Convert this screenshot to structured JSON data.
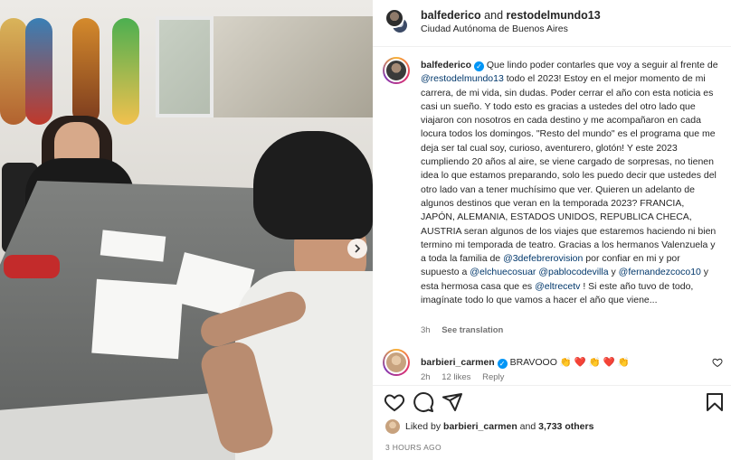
{
  "header": {
    "user1": "balfederico",
    "and_text": "and",
    "user2": "restodelmundo13",
    "location": "Ciudad Autónoma de Buenos Aires"
  },
  "caption": {
    "username": "balfederico",
    "t1": "Que lindo poder contarles que voy a seguir al frente de ",
    "m1": "@restodelmundo13",
    "t2": " todo el 2023! Estoy en el mejor momento de mi carrera, de mi vida, sin dudas. Poder cerrar el año con esta noticia es casi un sueño. Y todo esto es gracias a ustedes del otro lado que viajaron con nosotros en cada destino y me acompañaron en cada locura todos los domingos. \"Resto del mundo\" es el programa que me deja ser tal cual soy, curioso, aventurero, glotón! Y este 2023 cumpliendo 20 años al aire, se viene cargado de sorpresas, no tienen idea lo que estamos preparando, solo les puedo decir que ustedes del otro lado van a tener muchísimo que ver. Quieren un adelanto de algunos destinos que veran en la temporada 2023? FRANCIA, JAPÓN, ALEMANIA, ESTADOS UNIDOS, REPUBLICA CHECA, AUSTRIA seran algunos de los viajes que estaremos haciendo ni bien termino mi temporada de teatro. Gracias a los hermanos Valenzuela y a toda la familia de ",
    "m2": "@3defebrerovision",
    "t3": " por confiar en mi y por supuesto a ",
    "m3": "@elchuecosuar",
    "t4": " ",
    "m4": "@pablocodevilla",
    "t5": " y ",
    "m5": "@fernandezcoco10",
    "t6": " y esta hermosa casa que es ",
    "m6": "@eltrecetv",
    "t7": " ! Si este año tuvo de todo, imagínate todo lo que vamos a hacer el año que viene...",
    "time": "3h",
    "see_translation": "See translation"
  },
  "comment": {
    "username": "barbieri_carmen",
    "text": "BRAVOOO 👏 ❤️ 👏 ❤️ 👏",
    "time": "2h",
    "likes": "12 likes",
    "reply": "Reply"
  },
  "liked_by": {
    "prefix": "Liked by ",
    "user": "barbieri_carmen",
    "suffix": " and ",
    "count": "3,733 others"
  },
  "time_ago": "3 HOURS AGO",
  "icons": {
    "like": "heart-icon",
    "comment": "comment-icon",
    "share": "share-icon",
    "save": "bookmark-icon",
    "verified": "verified-badge-icon",
    "next": "chevron-right-icon"
  },
  "colors": {
    "link": "#00376b",
    "verified": "#0095f6",
    "muted": "#737373"
  }
}
